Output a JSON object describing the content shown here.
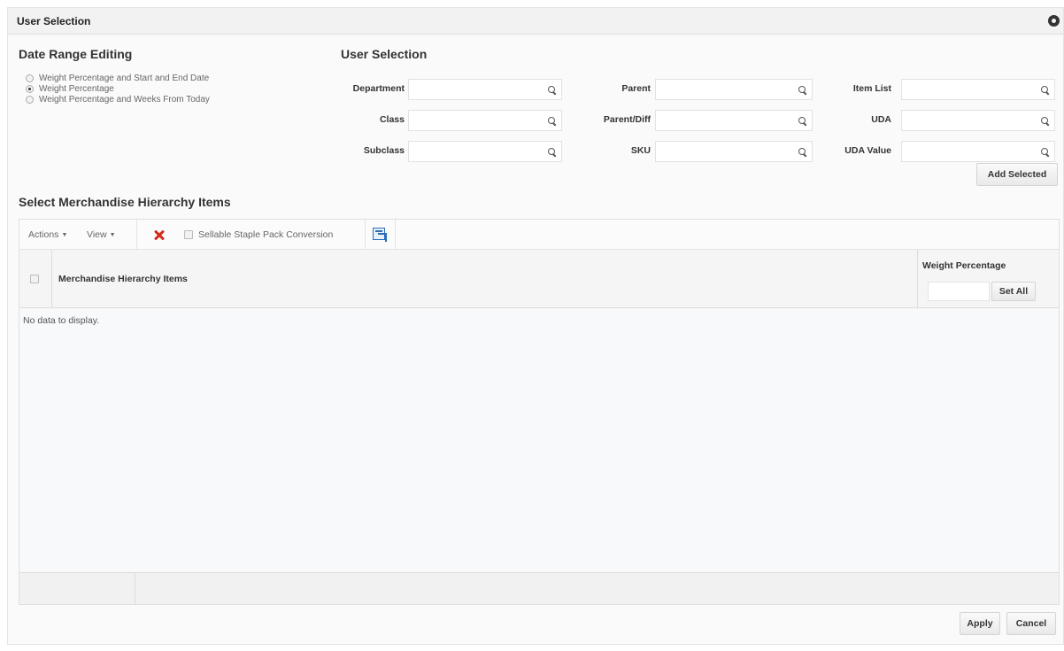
{
  "dialog": {
    "title": "User Selection"
  },
  "date_range": {
    "heading": "Date Range Editing",
    "options": [
      {
        "label": "Weight Percentage and Start and End Date",
        "selected": false
      },
      {
        "label": "Weight Percentage",
        "selected": true
      },
      {
        "label": "Weight Percentage and Weeks From Today",
        "selected": false
      }
    ]
  },
  "user_selection": {
    "heading": "User Selection",
    "fields": {
      "department": {
        "label": "Department",
        "value": ""
      },
      "class": {
        "label": "Class",
        "value": ""
      },
      "subclass": {
        "label": "Subclass",
        "value": ""
      },
      "parent": {
        "label": "Parent",
        "value": ""
      },
      "parent_diff": {
        "label": "Parent/Diff",
        "value": ""
      },
      "sku": {
        "label": "SKU",
        "value": ""
      },
      "item_list": {
        "label": "Item List",
        "value": ""
      },
      "uda": {
        "label": "UDA",
        "value": ""
      },
      "uda_value": {
        "label": "UDA Value",
        "value": ""
      }
    },
    "add_selected": "Add Selected"
  },
  "merch": {
    "heading": "Select Merchandise Hierarchy Items",
    "toolbar": {
      "actions": "Actions",
      "view": "View",
      "sellable_label": "Sellable Staple Pack Conversion"
    },
    "columns": {
      "items": "Merchandise Hierarchy Items",
      "weight": "Weight Percentage"
    },
    "set_all": "Set All",
    "weight_input_value": "",
    "empty_text": "No data to display."
  },
  "footer": {
    "apply": "Apply",
    "cancel": "Cancel"
  }
}
